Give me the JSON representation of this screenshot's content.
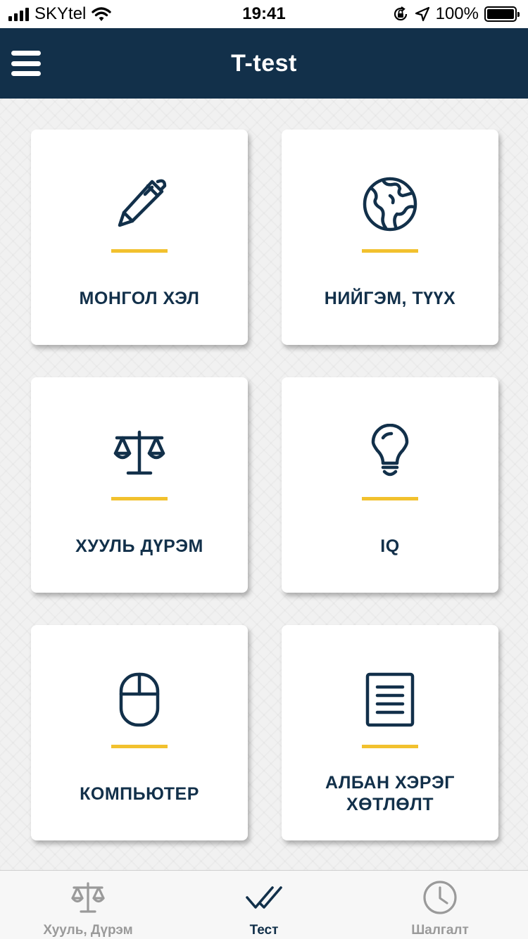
{
  "status_bar": {
    "carrier": "SKYtel",
    "time": "19:41",
    "battery": "100%",
    "icons": [
      "signal-icon",
      "wifi-icon",
      "orientation-lock-icon",
      "location-arrow-icon",
      "battery-icon"
    ]
  },
  "header": {
    "title": "T-test",
    "menu_icon": "hamburger-menu-icon"
  },
  "categories": [
    {
      "label": "МОНГОЛ ХЭЛ",
      "icon": "pen-icon"
    },
    {
      "label": "НИЙГЭМ, ТҮҮХ",
      "icon": "globe-icon"
    },
    {
      "label": "ХУУЛЬ ДҮРЭМ",
      "icon": "scales-icon"
    },
    {
      "label": "IQ",
      "icon": "lightbulb-icon"
    },
    {
      "label": "КОМПЬЮТЕР",
      "icon": "mouse-icon"
    },
    {
      "label": "АЛБАН ХЭРЭГ ХӨТЛӨЛТ",
      "icon": "document-icon"
    }
  ],
  "tabs": [
    {
      "label": "Хууль, Дүрэм",
      "icon": "scales-icon",
      "active": false
    },
    {
      "label": "Тест",
      "icon": "double-check-icon",
      "active": true
    },
    {
      "label": "Шалгалт",
      "icon": "clock-icon",
      "active": false
    }
  ],
  "colors": {
    "primary": "#12304a",
    "accent": "#f2c12e",
    "inactive_tab": "#9a9a9a"
  }
}
